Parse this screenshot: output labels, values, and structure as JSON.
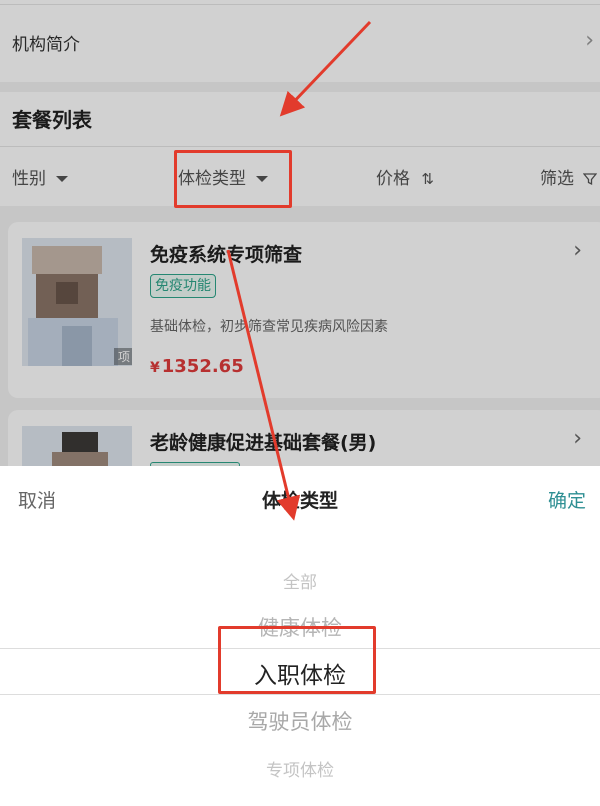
{
  "org_intro": {
    "label": "机构简介"
  },
  "package_list": {
    "title": "套餐列表",
    "filters": {
      "gender": "性别",
      "exam_type": "体检类型",
      "price": "价格",
      "price_icon": "⇅",
      "filter": "筛选"
    }
  },
  "cards": [
    {
      "title": "免疫系统专项筛查",
      "tag": "免疫功能",
      "description": "基础体检，初步筛查常见疾病风险因素",
      "currency": "¥",
      "price": "1352.65",
      "thumb_badge": "项"
    },
    {
      "title": "老龄健康促进基础套餐(男)"
    }
  ],
  "sheet": {
    "cancel": "取消",
    "title": "体检类型",
    "confirm": "确定",
    "options": [
      "全部",
      "健康体检",
      "入职体检",
      "驾驶员体检",
      "专项体检"
    ],
    "selected_index": 2
  },
  "colors": {
    "accent": "#2e8f93",
    "tag_green": "#2fa58b",
    "price_red": "#e03b3b",
    "annotation_red": "#e23b2c"
  }
}
